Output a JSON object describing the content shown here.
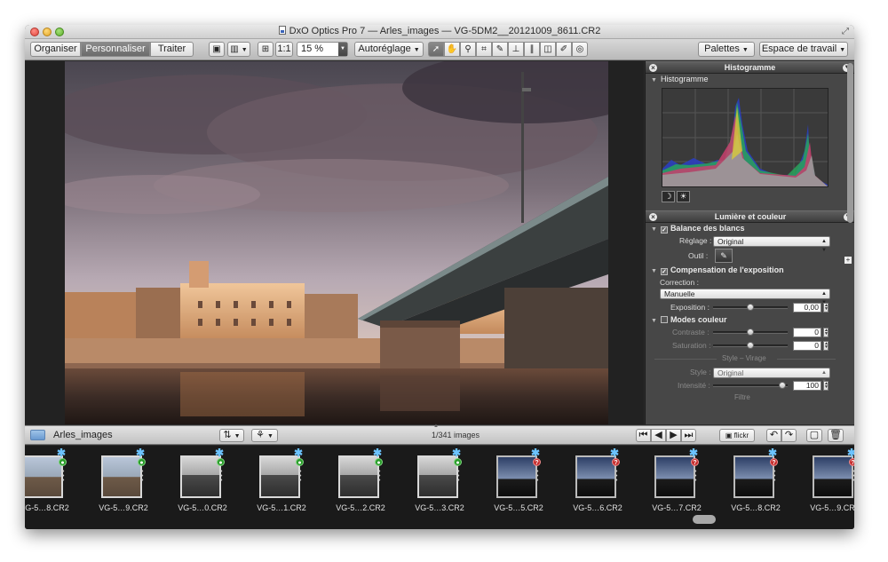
{
  "window": {
    "title": "DxO Optics Pro 7 — Arles_images — VG-5DM2__20121009_8611.CR2"
  },
  "toolbar": {
    "modes": [
      "Organiser",
      "Personnaliser",
      "Traiter"
    ],
    "active_mode": "Personnaliser",
    "fit_label": "1:1",
    "zoom_value": "15 %",
    "autoreglage_label": "Autoréglage",
    "palettes_label": "Palettes",
    "workspace_label": "Espace de travail",
    "tool_icons": [
      "pointer-icon",
      "hand-icon",
      "zoom-icon",
      "crop-icon",
      "eyedropper-icon",
      "horizon-icon",
      "perspective-icon",
      "red-eye-icon",
      "repair-icon",
      "spot-icon"
    ]
  },
  "histogram_palette": {
    "header": "Histogramme",
    "section": "Histogramme"
  },
  "light_palette": {
    "header": "Lumière et couleur",
    "white_balance": {
      "title": "Balance des blancs",
      "setting_label": "Réglage :",
      "setting_value": "Original",
      "tool_label": "Outil :"
    },
    "exposure": {
      "title": "Compensation de l'exposition",
      "correction_label": "Correction :",
      "correction_value": "Manuelle",
      "exposure_label": "Exposition :",
      "exposure_value": "0,00"
    },
    "color_modes": {
      "title": "Modes couleur",
      "contrast_label": "Contraste :",
      "contrast_value": "0",
      "saturation_label": "Saturation :",
      "saturation_value": "0",
      "style_divider": "Style – Virage",
      "style_label": "Style :",
      "style_value": "Original",
      "intensity_label": "Intensité :",
      "intensity_value": "100",
      "filter_divider": "Filtre"
    }
  },
  "browser": {
    "folder": "Arles_images",
    "count": "1/341 images",
    "flickr_label": "flickr"
  },
  "filmstrip": [
    {
      "name": "VG-5…8.CR2",
      "status": "ok"
    },
    {
      "name": "VG-5…9.CR2",
      "status": "ok"
    },
    {
      "name": "VG-5…0.CR2",
      "status": "ok"
    },
    {
      "name": "VG-5…1.CR2",
      "status": "ok"
    },
    {
      "name": "VG-5…2.CR2",
      "status": "ok"
    },
    {
      "name": "VG-5…3.CR2",
      "status": "ok"
    },
    {
      "name": "VG-5…5.CR2",
      "status": "warn"
    },
    {
      "name": "VG-5…6.CR2",
      "status": "warn"
    },
    {
      "name": "VG-5…7.CR2",
      "status": "warn"
    },
    {
      "name": "VG-5…8.CR2",
      "status": "warn"
    },
    {
      "name": "VG-5…9.CR2",
      "status": "warn"
    }
  ],
  "colors": {
    "status_ok": "#2a9c2a",
    "status_warn": "#c62e2e",
    "star": "#6cc3ff"
  }
}
